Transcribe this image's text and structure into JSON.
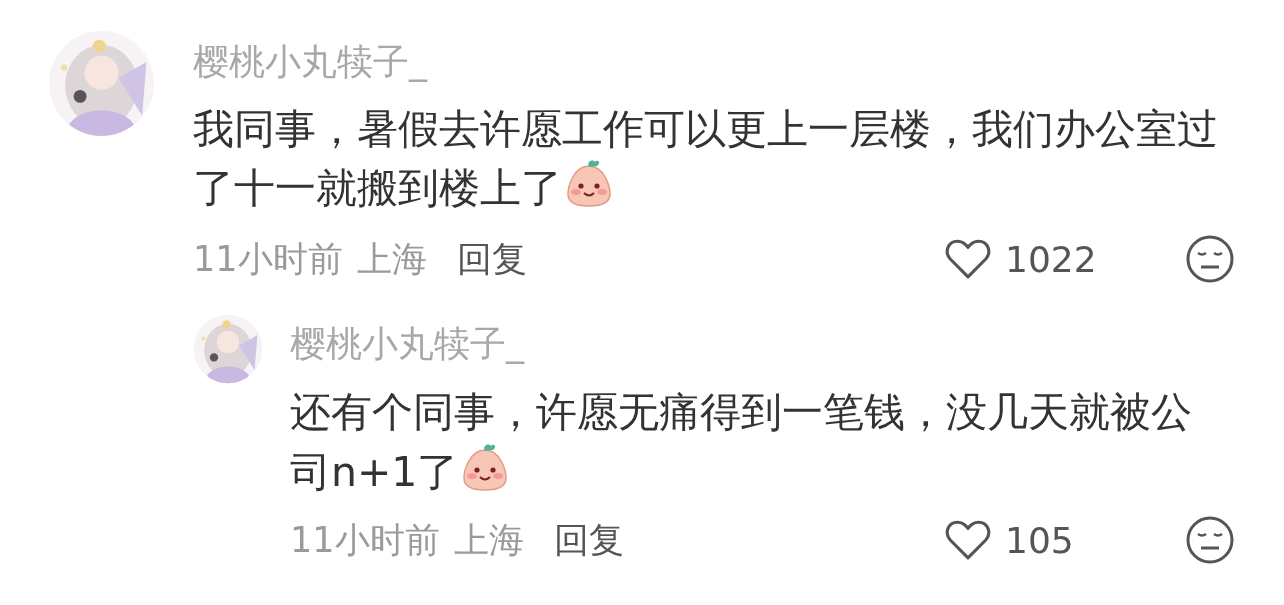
{
  "comments": [
    {
      "author": "樱桃小丸犊子_",
      "text": "我同事，暑假去许愿工作可以更上一层楼，我们办公室过了十一就搬到楼上了",
      "emoji": true,
      "time": "11小时前",
      "location": "上海",
      "reply_label": "回复",
      "likes": "1022",
      "kind": "top",
      "replies": [
        {
          "author": "樱桃小丸犊子_",
          "text": "还有个同事，许愿无痛得到一笔钱，没几天就被公司n+1了",
          "emoji": true,
          "time": "11小时前",
          "location": "上海",
          "reply_label": "回复",
          "likes": "105",
          "kind": "reply"
        }
      ]
    }
  ]
}
